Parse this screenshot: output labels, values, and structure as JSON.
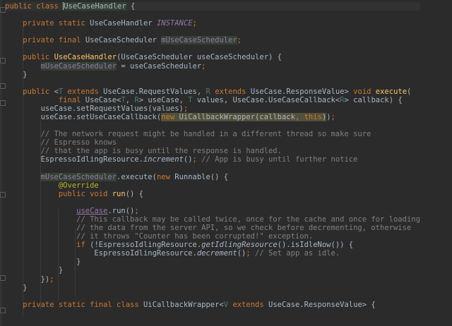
{
  "editor": {
    "lines": [
      [
        [
          "kw",
          "public class "
        ],
        [
          "hl",
          "UseCaseHandler"
        ],
        [
          "tx",
          " {"
        ]
      ],
      [],
      [
        [
          "tx",
          "    "
        ],
        [
          "kw",
          "private static "
        ],
        [
          "cls",
          "UseCaseHandler "
        ],
        [
          "sfld",
          "INSTANCE"
        ],
        [
          "kw",
          ";"
        ]
      ],
      [],
      [
        [
          "tx",
          "    "
        ],
        [
          "kw",
          "private final "
        ],
        [
          "cls",
          "UseCaseScheduler "
        ],
        [
          "fldhl",
          "mUseCaseScheduler"
        ],
        [
          "kw",
          ";"
        ]
      ],
      [],
      [
        [
          "tx",
          "    "
        ],
        [
          "kw",
          "public "
        ],
        [
          "mth",
          "UseCaseHandler"
        ],
        [
          "tx",
          "(UseCaseScheduler useCaseScheduler) {"
        ]
      ],
      [
        [
          "tx",
          "        "
        ],
        [
          "fldhl",
          "mUseCaseScheduler"
        ],
        [
          "tx",
          " = useCaseScheduler"
        ],
        [
          "kw",
          ";"
        ]
      ],
      [
        [
          "tx",
          "    }"
        ]
      ],
      [],
      [
        [
          "tx",
          "    "
        ],
        [
          "kw",
          "public "
        ],
        [
          "tx",
          "<"
        ],
        [
          "tp",
          "T "
        ],
        [
          "kw",
          "extends "
        ],
        [
          "tx",
          "UseCase.RequestValues, "
        ],
        [
          "tp",
          "R "
        ],
        [
          "kw",
          "extends "
        ],
        [
          "tx",
          "UseCase.ResponseValue> "
        ],
        [
          "kw",
          "void "
        ],
        [
          "mth",
          "execute"
        ],
        [
          "tx",
          "("
        ]
      ],
      [
        [
          "tx",
          "            "
        ],
        [
          "kw",
          "final "
        ],
        [
          "tx",
          "UseCase<"
        ],
        [
          "tp",
          "T"
        ],
        [
          "tx",
          ", "
        ],
        [
          "tp",
          "R"
        ],
        [
          "tx",
          "> useCase, "
        ],
        [
          "tp",
          "T "
        ],
        [
          "tx",
          "values, UseCase.UseCaseCallback<"
        ],
        [
          "tp",
          "R"
        ],
        [
          "tx",
          "> callback) {"
        ]
      ],
      [
        [
          "tx",
          "        useCase.setRequestValues(values)"
        ],
        [
          "kw",
          ";"
        ]
      ],
      [
        [
          "tx",
          "        useCase.setUseCaseCallback("
        ],
        [
          "hlwkw",
          "new "
        ],
        [
          "hlw",
          "UiCallbackWrapper(callback"
        ],
        [
          "hlwkw",
          ", this"
        ],
        [
          "hlw",
          ")"
        ],
        [
          "tx",
          ")"
        ],
        [
          "kw",
          ";"
        ]
      ],
      [],
      [
        [
          "cmt",
          "        // The network request might be handled in a different thread so make sure"
        ]
      ],
      [
        [
          "cmt",
          "        // Espresso knows"
        ]
      ],
      [
        [
          "cmt",
          "        // that the app is busy until the response is handled."
        ]
      ],
      [
        [
          "tx",
          "        EspressoIdlingResource."
        ],
        [
          "sm",
          "increment"
        ],
        [
          "tx",
          "()"
        ],
        [
          "kw",
          "; "
        ],
        [
          "cmt",
          "// App is busy until further notice"
        ]
      ],
      [],
      [
        [
          "tx",
          "        "
        ],
        [
          "fldhl",
          "mUseCaseScheduler"
        ],
        [
          "tx",
          ".execute("
        ],
        [
          "kw",
          "new "
        ],
        [
          "tx",
          "Runnable() {"
        ]
      ],
      [
        [
          "tx",
          "            "
        ],
        [
          "ann",
          "@Override"
        ]
      ],
      [
        [
          "tx",
          "            "
        ],
        [
          "kw",
          "public void "
        ],
        [
          "mth",
          "run"
        ],
        [
          "tx",
          "() {"
        ]
      ],
      [],
      [
        [
          "tx",
          "                "
        ],
        [
          "pl",
          "useCase"
        ],
        [
          "tx",
          ".run()"
        ],
        [
          "kw",
          ";"
        ]
      ],
      [
        [
          "cmt",
          "                // This callback may be called twice, once for the cache and once for loading"
        ]
      ],
      [
        [
          "cmt",
          "                // the data from the server API, so we check before decrementing, otherwise"
        ]
      ],
      [
        [
          "cmt",
          "                // it throws \"Counter has been corrupted!\" exception."
        ]
      ],
      [
        [
          "tx",
          "                "
        ],
        [
          "kw",
          "if "
        ],
        [
          "tx",
          "(!EspressoIdlingResource."
        ],
        [
          "sm",
          "getIdlingResource"
        ],
        [
          "tx",
          "().isIdleNow()) {"
        ]
      ],
      [
        [
          "tx",
          "                    EspressoIdlingResource."
        ],
        [
          "sm",
          "decrement"
        ],
        [
          "tx",
          "()"
        ],
        [
          "kw",
          "; "
        ],
        [
          "cmt",
          "// Set app as idle."
        ]
      ],
      [
        [
          "tx",
          "                }"
        ]
      ],
      [
        [
          "tx",
          "            }"
        ]
      ],
      [
        [
          "tx",
          "        })"
        ],
        [
          "kw",
          ";"
        ]
      ],
      [
        [
          "tx",
          "    }"
        ]
      ],
      [],
      [
        [
          "tx",
          "    "
        ],
        [
          "kw",
          "private static final class "
        ],
        [
          "tx",
          "UiCallbackWrapper<"
        ],
        [
          "tp",
          "V "
        ],
        [
          "kw",
          "extends "
        ],
        [
          "tx",
          "UseCase.ResponseValue> {"
        ]
      ]
    ]
  }
}
